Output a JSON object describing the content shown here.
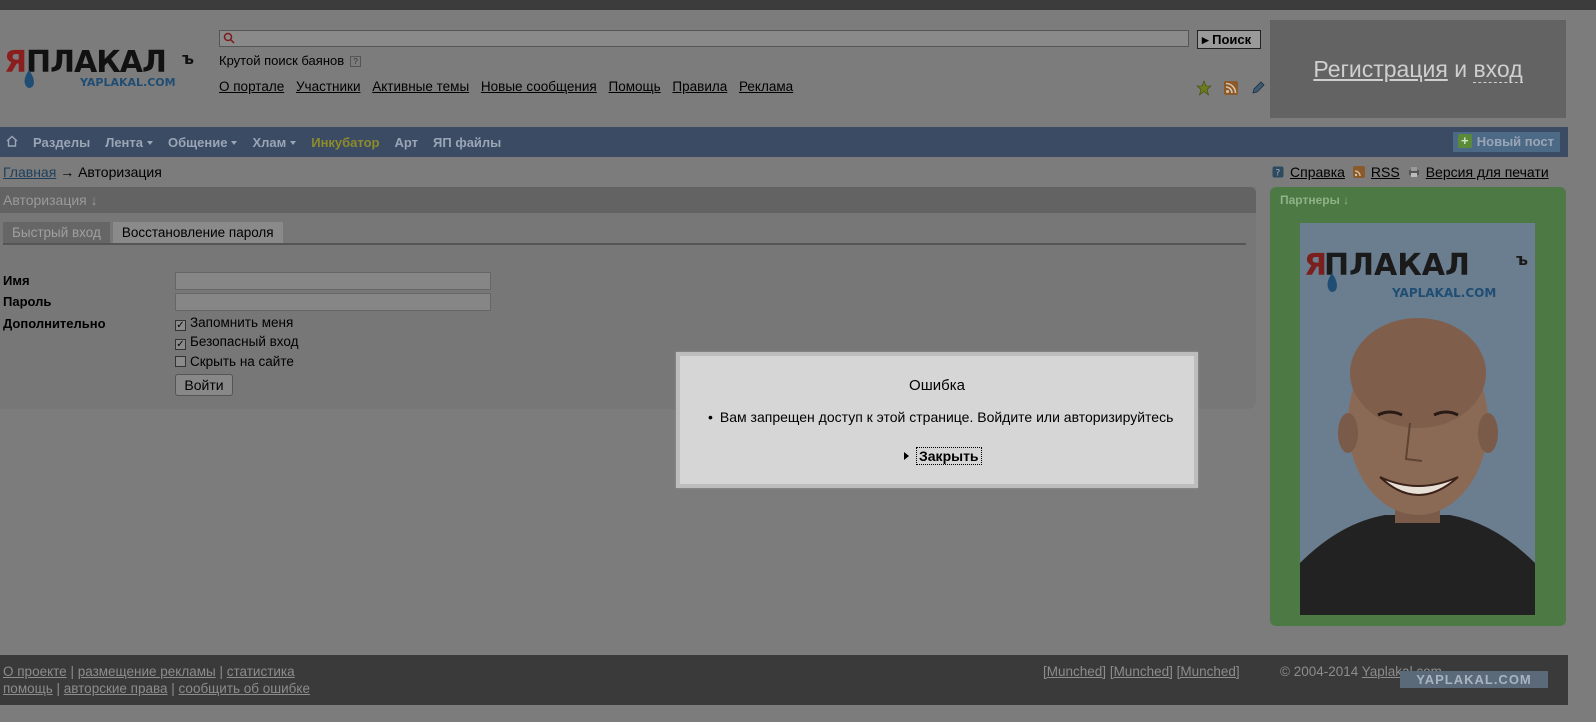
{
  "header": {
    "logo_main": "ЯПЛАКАЛЪ",
    "logo_sub": "YAPLAKAL.COM",
    "search": {
      "placeholder": "",
      "button_label": "Поиск"
    },
    "tagline": "Крутой поиск баянов",
    "top_links": [
      "О портале",
      "Участники",
      "Активные темы",
      "Новые сообщения",
      "Помощь",
      "Правила",
      "Реклама"
    ],
    "register": {
      "label1": "Регистрация",
      "sep": "и",
      "label2": "вход"
    }
  },
  "nav": {
    "items": [
      {
        "label": "Разделы",
        "caret": false
      },
      {
        "label": "Лента",
        "caret": true
      },
      {
        "label": "Общение",
        "caret": true
      },
      {
        "label": "Хлам",
        "caret": true
      },
      {
        "label": "Инкубатор",
        "caret": false
      },
      {
        "label": "Арт",
        "caret": false
      },
      {
        "label": "ЯП файлы",
        "caret": false
      }
    ],
    "new_post": "Новый пост"
  },
  "breadcrumb": {
    "home": "Главная",
    "arrow": "→",
    "current": "Авторизация"
  },
  "help_links": {
    "help": "Справка",
    "rss": "RSS",
    "print": "Версия для печати"
  },
  "auth": {
    "title": "Авторизация ↓",
    "tabs": [
      "Быстрый вход",
      "Восстановление пароля"
    ],
    "name_label": "Имя",
    "password_label": "Пароль",
    "extra_label": "Дополнительно",
    "remember": "Запомнить меня",
    "secure": "Безопасный вход",
    "hide": "Скрыть на сайте",
    "login_button": "Войти"
  },
  "partners": {
    "title": "Партнеры ↓",
    "logo_main": "ЯПЛАКАЛЪ",
    "logo_sub": "YAPLAKAL.COM"
  },
  "footer": {
    "row1": [
      "О проекте",
      "размещение рекламы",
      "статистика"
    ],
    "row2": [
      "помощь",
      "авторские права",
      "сообщить об ошибке"
    ],
    "munched": [
      "[Munched]",
      "[Munched]",
      "[Munched]"
    ],
    "copyright": "© 2004-2014",
    "copyright_link": "Yaplakal.com",
    "watermark": "YAPLAKAL.COM"
  },
  "modal": {
    "title": "Ошибка",
    "message": "Вам запрещен доступ к этой странице. Войдите или авторизируйтесь",
    "close_label": "Закрыть"
  },
  "colors": {
    "nav_bg": "#3b4b63",
    "partners_bg": "#4d7a44",
    "overlay": "#7c7c7c"
  }
}
